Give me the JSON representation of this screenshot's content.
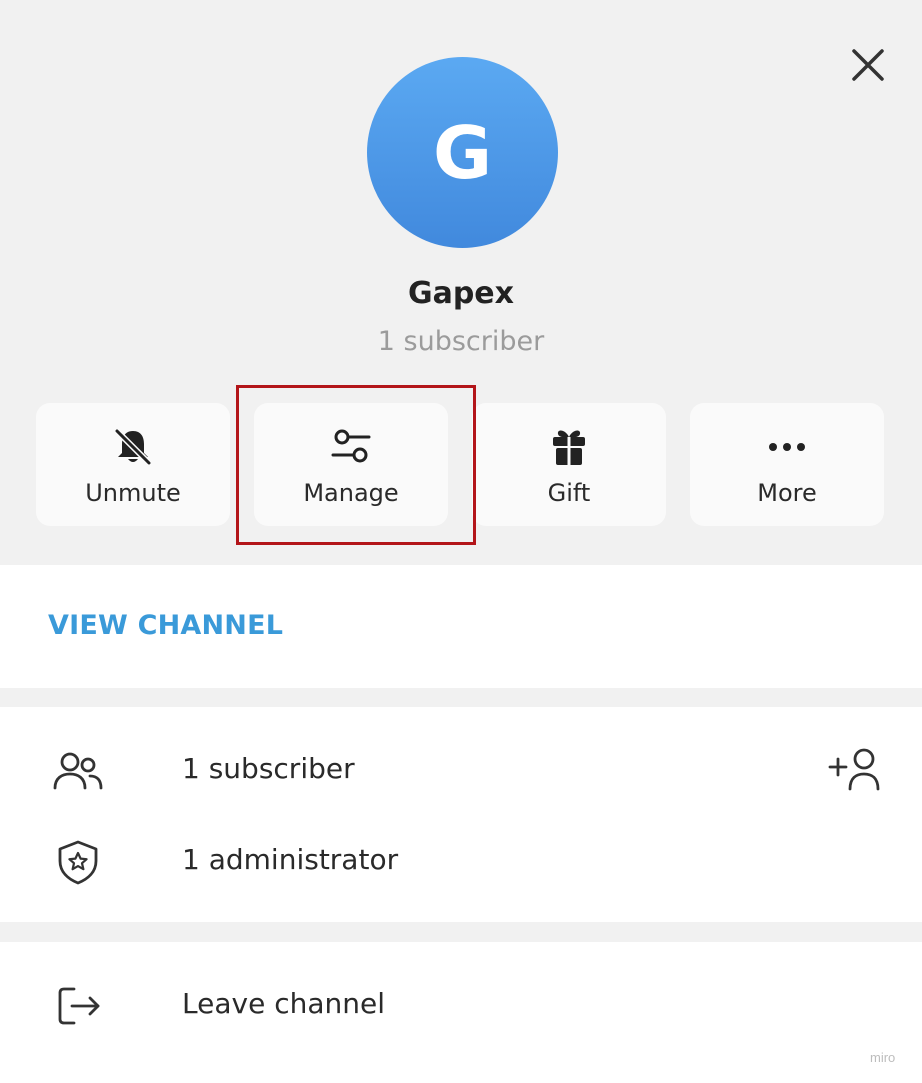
{
  "profile": {
    "avatar_letter": "G",
    "name": "Gapex",
    "subscribers": "1 subscriber"
  },
  "actions": [
    {
      "label": "Unmute",
      "icon": "bell-off-icon"
    },
    {
      "label": "Manage",
      "icon": "sliders-icon"
    },
    {
      "label": "Gift",
      "icon": "gift-icon"
    },
    {
      "label": "More",
      "icon": "more-icon"
    }
  ],
  "view_channel": "VIEW CHANNEL",
  "info": {
    "subscribers": "1 subscriber",
    "administrators": "1 administrator"
  },
  "leave": "Leave channel",
  "watermark": "miro",
  "colors": {
    "accent": "#3a9ad9",
    "avatar": "#4a96e6",
    "highlight": "#b3151a"
  }
}
